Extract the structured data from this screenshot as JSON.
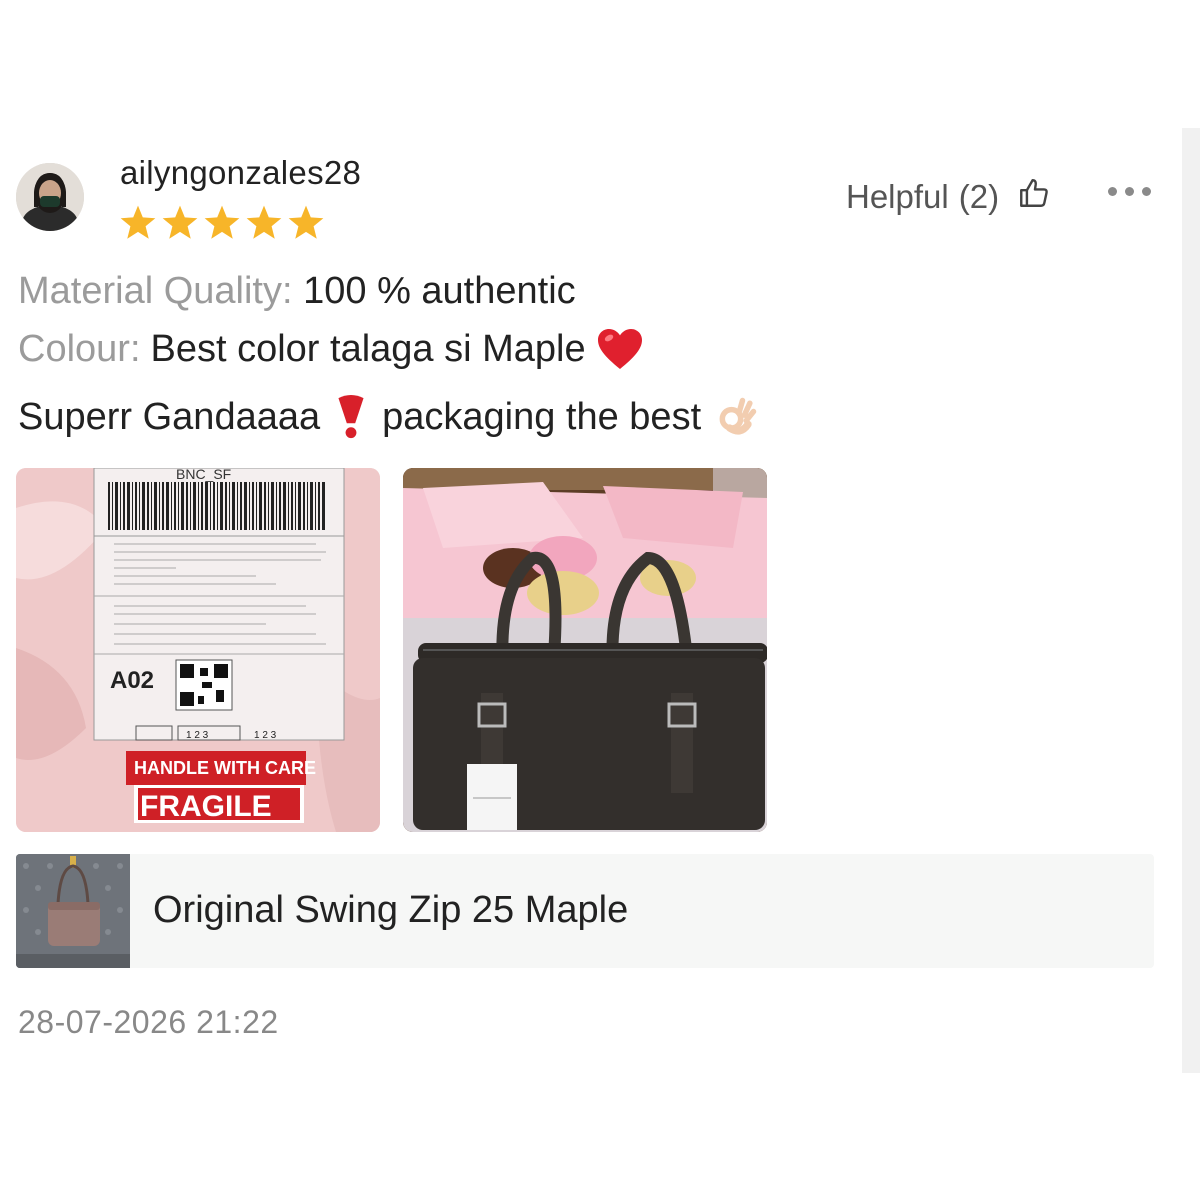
{
  "review": {
    "username": "ailyngonzales28",
    "rating": 5,
    "rating_max": 5,
    "helpful_label": "Helpful",
    "helpful_count": "(2)",
    "material_key": "Material Quality:",
    "material_value": "100 % authentic",
    "colour_key": "Colour:",
    "colour_value": "Best color talaga si Maple",
    "comment_part1": "Superr Gandaaaa",
    "comment_part2": "packaging the best",
    "timestamp": "28-07-2026 21:22",
    "photos": [
      {
        "label_top": "BNC_SF",
        "code": "A02",
        "sticker1": "HANDLE WITH CARE",
        "sticker2": "FRAGILE"
      },
      {}
    ]
  },
  "product": {
    "name": "Original Swing Zip 25 Maple"
  },
  "icons": {
    "thumb": "thumbs-up-icon",
    "more": "more-icon",
    "star": "star-icon",
    "heart": "red-heart-emoji",
    "exclamation": "red-exclamation-emoji",
    "ok": "ok-hand-emoji"
  },
  "colors": {
    "star": "#f7b529",
    "key_text": "#9b9b9b",
    "heart": "#e0202e"
  }
}
